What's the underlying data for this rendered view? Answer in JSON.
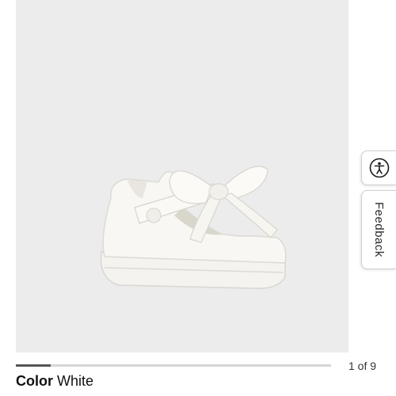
{
  "gallery": {
    "current_page": 1,
    "total_pages": 9,
    "counter_text": "1 of 9",
    "progress_fraction": 0.111
  },
  "side_tabs": {
    "accessibility_icon": "accessibility-icon",
    "feedback_label": "Feedback"
  },
  "product": {
    "color_label": "Color",
    "color_value": "White"
  },
  "colors": {
    "gallery_bg": "#ececec",
    "progress_fill": "#555555",
    "progress_track": "#d6d6d6"
  }
}
